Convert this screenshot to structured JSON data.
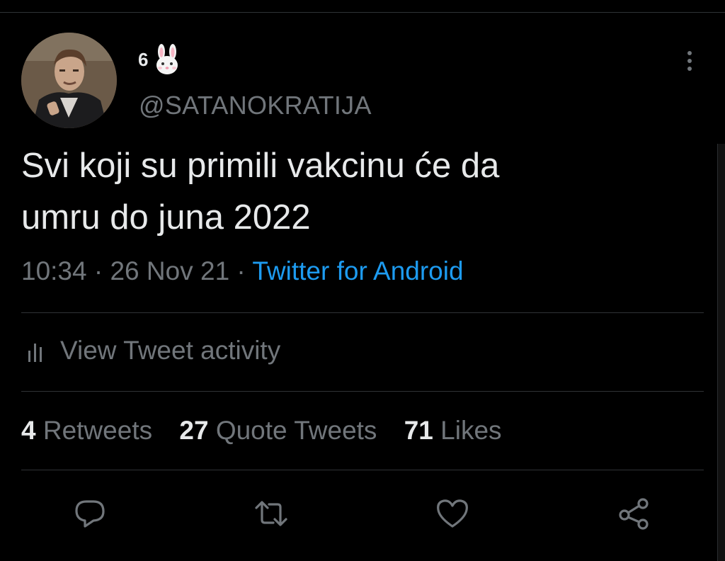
{
  "tweet": {
    "display_name": "6",
    "display_name_emoji": "rabbit-face-emoji",
    "handle": "@SATANOKRATIJA",
    "text_line1": "Svi koji su primili vakcinu će da",
    "text_line2": "umru do juna 2022",
    "time": "10:34",
    "separator": " · ",
    "date": "26 Nov 21",
    "source": "Twitter for Android"
  },
  "activity": {
    "label": "View Tweet activity",
    "icon": "chart-bars-icon"
  },
  "stats": {
    "retweets_count": "4",
    "retweets_label": "Retweets",
    "quotes_count": "27",
    "quotes_label": "Quote Tweets",
    "likes_count": "71",
    "likes_label": "Likes"
  },
  "actions": [
    "reply-icon",
    "retweet-icon",
    "like-icon",
    "share-icon"
  ],
  "colors": {
    "background": "#000000",
    "text": "#e7e9ea",
    "secondary": "#71767b",
    "link": "#1d9bf0",
    "divider": "#2f3336"
  }
}
